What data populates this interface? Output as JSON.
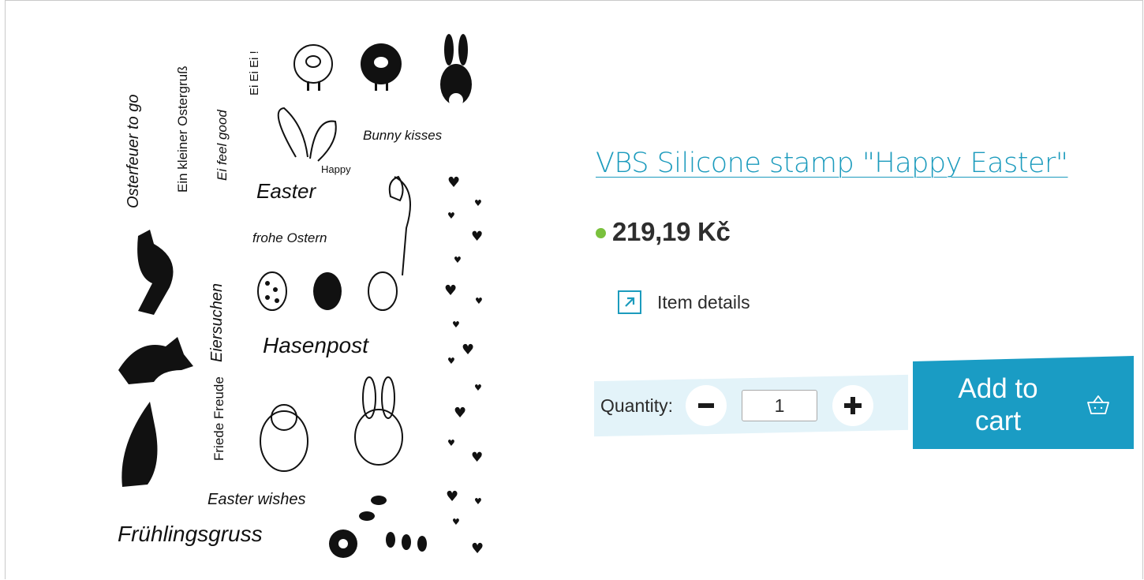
{
  "product": {
    "title": "VBS Silicone stamp \"Happy Easter\"",
    "price": "219,19 Kč",
    "stock_color": "#7ac13d",
    "details_label": "Item details",
    "quantity_label": "Quantity:",
    "quantity_value": "1",
    "add_to_cart_label": "Add to cart",
    "icons": [
      "external-link-icon",
      "minus-icon",
      "plus-icon",
      "basket-icon"
    ]
  },
  "image_text": {
    "t1": "Osterfeuer to go",
    "t2": "Ein kleiner Ostergruß",
    "t3": "Ei feel good",
    "t4": "Ei Ei Ei !",
    "t5": "Bunny kisses",
    "t6": "Happy",
    "t7": "Easter",
    "t8": "frohe Ostern",
    "t9": "Eiersuchen",
    "t10": "Hasenpost",
    "t11": "Friede Freude",
    "t12": "Easter wishes",
    "t13": "Frühlingsgruss"
  },
  "colors": {
    "accent": "#1c9bbd",
    "button": "#1a9cc4",
    "qty_bg": "#e3f3f9",
    "text": "#2e2e2e"
  }
}
